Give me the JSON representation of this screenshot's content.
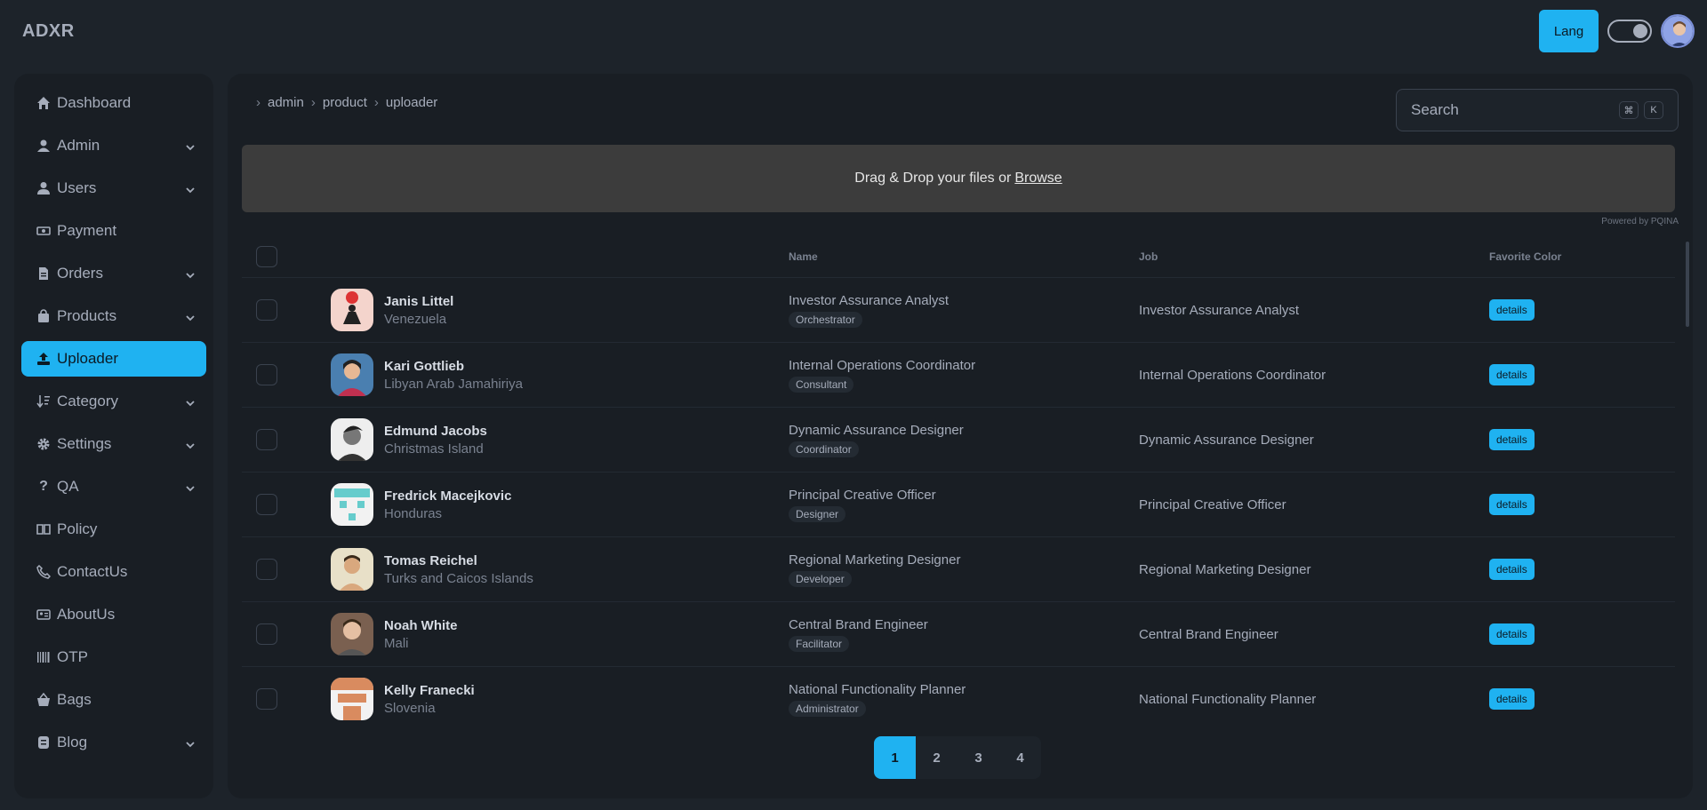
{
  "app": {
    "brand": "ADXR"
  },
  "topbar": {
    "lang_label": "Lang"
  },
  "sidebar": {
    "items": [
      {
        "label": "Dashboard",
        "icon": "home-icon",
        "expandable": false
      },
      {
        "label": "Admin",
        "icon": "admin-icon",
        "expandable": true
      },
      {
        "label": "Users",
        "icon": "user-icon",
        "expandable": true
      },
      {
        "label": "Payment",
        "icon": "money-icon",
        "expandable": false
      },
      {
        "label": "Orders",
        "icon": "file-icon",
        "expandable": true
      },
      {
        "label": "Products",
        "icon": "bag-icon",
        "expandable": true
      },
      {
        "label": "Uploader",
        "icon": "upload-icon",
        "expandable": false,
        "active": true
      },
      {
        "label": "Category",
        "icon": "sort-icon",
        "expandable": true
      },
      {
        "label": "Settings",
        "icon": "gear-icon",
        "expandable": true
      },
      {
        "label": "QA",
        "icon": "question-icon",
        "expandable": true
      },
      {
        "label": "Policy",
        "icon": "book-icon",
        "expandable": false
      },
      {
        "label": "ContactUs",
        "icon": "phone-icon",
        "expandable": false
      },
      {
        "label": "AboutUs",
        "icon": "id-card-icon",
        "expandable": false
      },
      {
        "label": "OTP",
        "icon": "barcode-icon",
        "expandable": false
      },
      {
        "label": "Bags",
        "icon": "basket-icon",
        "expandable": false
      },
      {
        "label": "Blog",
        "icon": "blog-icon",
        "expandable": true
      }
    ]
  },
  "breadcrumb": [
    "admin",
    "product",
    "uploader"
  ],
  "search": {
    "placeholder": "Search",
    "kbd1": "⌘",
    "kbd2": "K"
  },
  "uploader": {
    "text": "Drag & Drop your files or",
    "browse": "Browse",
    "powered": "Powered by PQINA"
  },
  "table": {
    "headers": {
      "name": "Name",
      "job": "Job",
      "color": "Favorite Color"
    },
    "details_label": "details",
    "rows": [
      {
        "name": "Janis Littel",
        "country": "Venezuela",
        "job": "Investor Assurance Analyst",
        "badge": "Orchestrator",
        "job2": "Investor Assurance Analyst"
      },
      {
        "name": "Kari Gottlieb",
        "country": "Libyan Arab Jamahiriya",
        "job": "Internal Operations Coordinator",
        "badge": "Consultant",
        "job2": "Internal Operations Coordinator"
      },
      {
        "name": "Edmund Jacobs",
        "country": "Christmas Island",
        "job": "Dynamic Assurance Designer",
        "badge": "Coordinator",
        "job2": "Dynamic Assurance Designer"
      },
      {
        "name": "Fredrick Macejkovic",
        "country": "Honduras",
        "job": "Principal Creative Officer",
        "badge": "Designer",
        "job2": "Principal Creative Officer"
      },
      {
        "name": "Tomas Reichel",
        "country": "Turks and Caicos Islands",
        "job": "Regional Marketing Designer",
        "badge": "Developer",
        "job2": "Regional Marketing Designer"
      },
      {
        "name": "Noah White",
        "country": "Mali",
        "job": "Central Brand Engineer",
        "badge": "Facilitator",
        "job2": "Central Brand Engineer"
      },
      {
        "name": "Kelly Franecki",
        "country": "Slovenia",
        "job": "National Functionality Planner",
        "badge": "Administrator",
        "job2": "National Functionality Planner"
      }
    ]
  },
  "pagination": {
    "pages": [
      "1",
      "2",
      "3",
      "4"
    ],
    "active": "1"
  },
  "colors": {
    "accent": "#1fb2f1",
    "bg": "#1d232a",
    "panel": "#191e24"
  }
}
